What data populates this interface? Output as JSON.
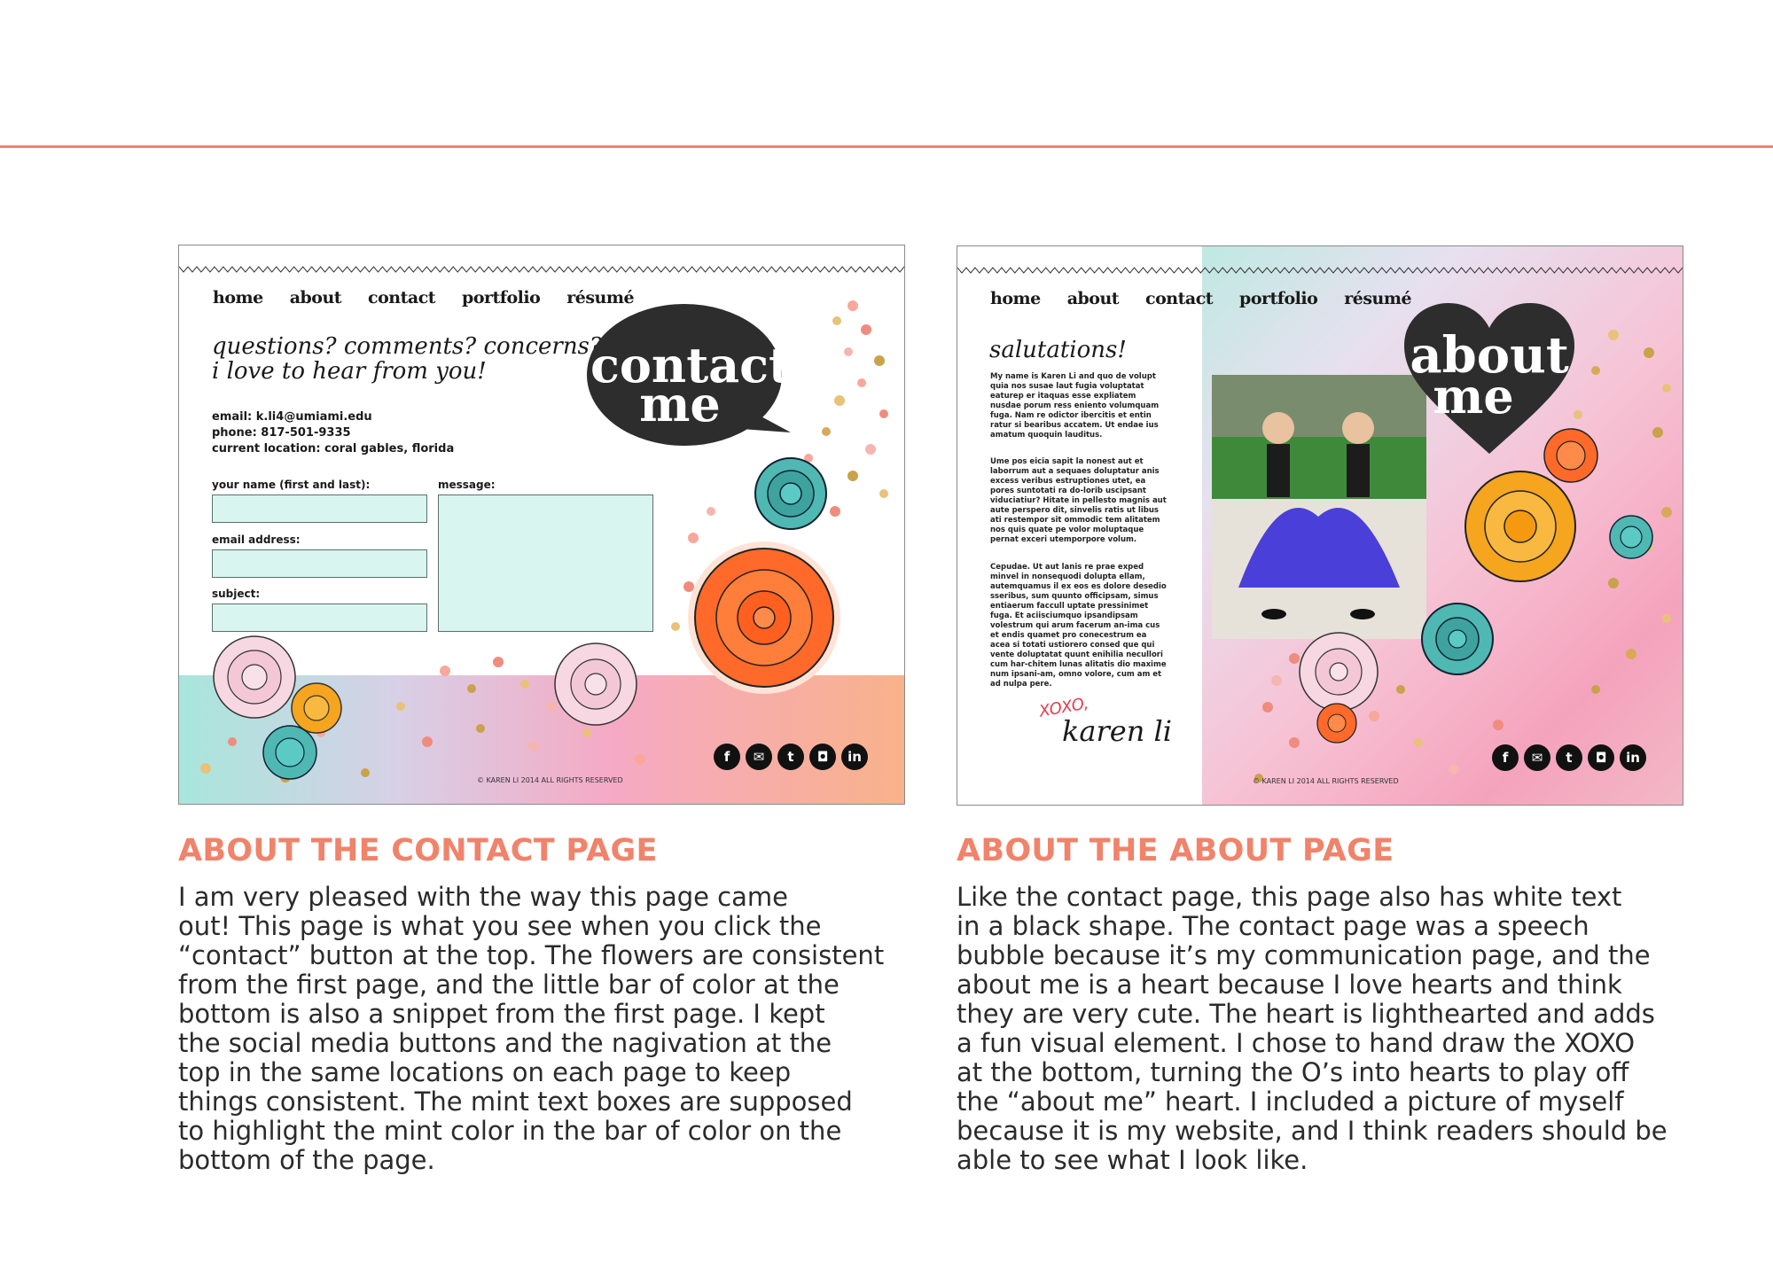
{
  "colors": {
    "accent": "#f0836a",
    "mint": "#d8f5f0",
    "bubble": "#2d2d2d"
  },
  "contact_mock": {
    "nav": [
      "home",
      "about",
      "contact",
      "portfolio",
      "résumé"
    ],
    "heading_line1": "questions? comments? concerns?",
    "heading_line2": "i love to hear from you!",
    "bubble_line1": "contact",
    "bubble_line2": "me",
    "email": "email: k.li4@umiami.edu",
    "phone": "phone: 817-501-9335",
    "location": "current location: coral gables, florida",
    "form": {
      "name_label": "your name (first and last):",
      "email_label": "email address:",
      "subject_label": "subject:",
      "message_label": "message:"
    },
    "social_icons": [
      "facebook-icon",
      "mail-icon",
      "twitter-icon",
      "instagram-icon",
      "linkedin-icon"
    ],
    "copyright": "© KAREN LI 2014 ALL RIGHTS RESERVED"
  },
  "about_mock": {
    "nav": [
      "home",
      "about",
      "contact",
      "portfolio",
      "résumé"
    ],
    "heading": "salutations!",
    "heart_line1": "about",
    "heart_line2": "me",
    "bio_p1": "My name is Karen Li and quo de volupt quia nos susae laut fugia voluptatat eaturep er itaquas esse expliatem nusdae porum ress eniento volumquam fuga. Nam re odictor ibercitis et entin ratur si bearibus accatem. Ut endae ius amatum quoquin lauditus.",
    "bio_p2": "Ume pos eicia sapit la nonest aut et laborrum aut a sequaes doluptatur anis excess veribus estruptiones utet, ea pores suntotati ra do-lorib uscipsant viduciatiur? Hitate in pellesto magnis aut aute perspero dit, sinvelis ratis ut libus ati restempor sit ommodic tem alitatem nos quis quate pe volor moluptaque pernat exceri utemporpore volum.",
    "bio_p3": "Cepudae. Ut aut lanis re prae exped minvel in nonsequodi dolupta ellam, autemquamus il ex eos es dolore desedio sseribus, sum quunto officipsam, simus entiaerum faccull uptate pressinimet fuga. Et aciisciumquo ipsandipsam volestrum qui arum facerum an-ima cus et endis quamet pro conecestrum ea acea si totati ustiorero consed que qui vente doluptatat quunt enihilia necullori cum har-chitem lunas alitatis dio maxime num ipsani-am, omno volore, cum am et ad nulpa pere.",
    "signature_xoxo": "XOXO,",
    "signature_name": "karen li",
    "social_icons": [
      "facebook-icon",
      "mail-icon",
      "twitter-icon",
      "instagram-icon",
      "linkedin-icon"
    ],
    "copyright": "© KAREN LI 2014 ALL RIGHTS RESERVED"
  },
  "captions": {
    "contact_title": "ABOUT THE CONTACT PAGE",
    "contact_lines": [
      "I am very pleased with the way this page came",
      "out! This page is what you see when you click the",
      "“contact” button at the top. The flowers are consistent",
      "from the first page, and the little bar of color at the",
      "bottom is also a snippet from the first page. I kept",
      "the social media buttons and the nagivation at the",
      "top in the same locations on each page to keep",
      "things consistent. The mint text boxes are supposed",
      "to highlight the mint color in the bar of color on the",
      "bottom of the page."
    ],
    "about_title": "ABOUT THE ABOUT PAGE",
    "about_lines": [
      "Like the contact page, this page also has white text",
      "in a black shape. The contact page was a speech",
      "bubble because it’s my communication page, and the",
      "about me is a heart because I love hearts and think",
      "they are very cute. The heart is lighthearted and adds",
      "a fun visual element. I chose to hand draw the XOXO",
      "at the bottom, turning the O’s into hearts to play off",
      "the “about me” heart. I included a picture of myself",
      "because it is my website, and I think readers should be",
      "able to see what I look like."
    ]
  }
}
